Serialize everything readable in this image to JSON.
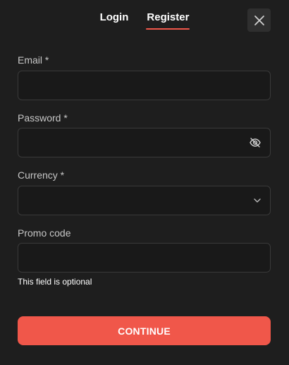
{
  "tabs": [
    {
      "label": "Login",
      "active": false
    },
    {
      "label": "Register",
      "active": true
    }
  ],
  "icons": {
    "close": "close-icon",
    "password_visibility": "eye-off-icon",
    "currency_dropdown": "chevron-down-icon"
  },
  "form": {
    "email": {
      "label": "Email *",
      "value": "",
      "placeholder": ""
    },
    "password": {
      "label": "Password *",
      "value": "",
      "placeholder": ""
    },
    "currency": {
      "label": "Currency *",
      "value": ""
    },
    "promo": {
      "label": "Promo code",
      "value": "",
      "placeholder": "",
      "hint": "This field is optional"
    }
  },
  "submit_label": "CONTINUE",
  "colors": {
    "accent": "#f0574a",
    "background": "#1e1e1e",
    "field_border": "#3a3a3a"
  }
}
